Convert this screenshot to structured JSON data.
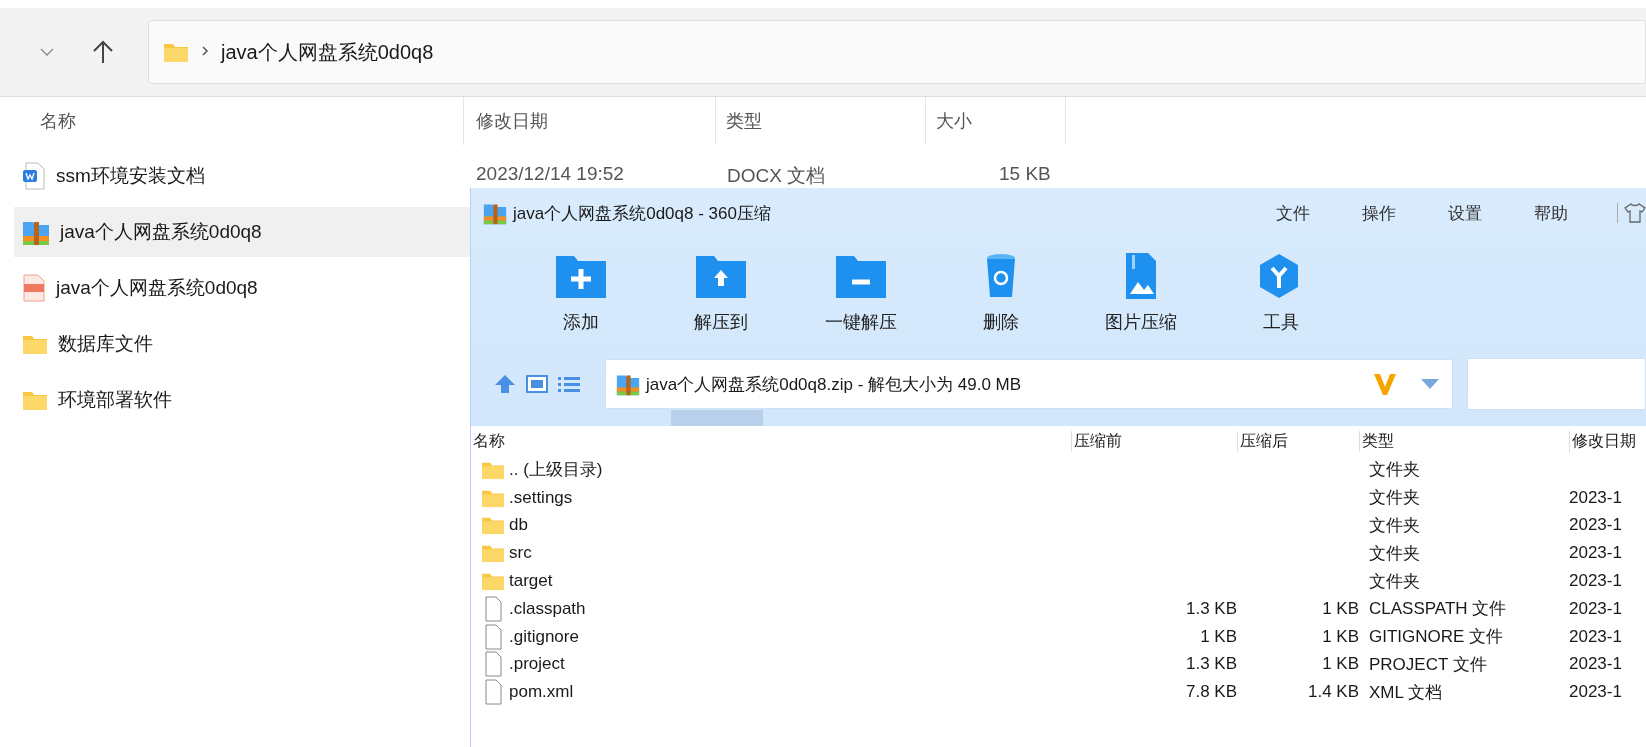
{
  "explorer": {
    "path": "java个人网盘系统0d0q8",
    "columns": [
      "名称",
      "修改日期",
      "类型",
      "大小"
    ],
    "files": [
      {
        "name": "ssm环境安装文档",
        "kind": "word",
        "selected": false,
        "date": "2023/12/14 19:52",
        "type": "DOCX 文档",
        "size": "15 KB"
      },
      {
        "name": "java个人网盘系统0d0q8",
        "kind": "zip",
        "selected": true
      },
      {
        "name": "java个人网盘系统0d0q8",
        "kind": "mp4",
        "selected": false
      },
      {
        "name": "数据库文件",
        "kind": "folder",
        "selected": false
      },
      {
        "name": "环境部署软件",
        "kind": "folder",
        "selected": false
      }
    ]
  },
  "archiver": {
    "title": "java个人网盘系统0d0q8 - 360压缩",
    "menu": [
      "文件",
      "操作",
      "设置",
      "帮助"
    ],
    "tools": [
      {
        "label": "添加",
        "kind": "add"
      },
      {
        "label": "解压到",
        "kind": "extract"
      },
      {
        "label": "一键解压",
        "kind": "oneclick"
      },
      {
        "label": "删除",
        "kind": "delete"
      },
      {
        "label": "图片压缩",
        "kind": "image"
      },
      {
        "label": "工具",
        "kind": "tools"
      }
    ],
    "address": "java个人网盘系统0d0q8.zip - 解包大小为 49.0 MB",
    "columns": [
      "名称",
      "压缩前",
      "压缩后",
      "类型",
      "修改日期"
    ],
    "rows": [
      {
        "kind": "folder",
        "name": ".. (上级目录)",
        "type": "文件夹"
      },
      {
        "kind": "folder",
        "name": ".settings",
        "type": "文件夹",
        "date": "2023-1"
      },
      {
        "kind": "folder",
        "name": "db",
        "type": "文件夹",
        "date": "2023-1"
      },
      {
        "kind": "folder",
        "name": "src",
        "type": "文件夹",
        "date": "2023-1"
      },
      {
        "kind": "folder",
        "name": "target",
        "type": "文件夹",
        "date": "2023-1"
      },
      {
        "kind": "file",
        "name": ".classpath",
        "before": "1.3 KB",
        "after": "1 KB",
        "type": "CLASSPATH 文件",
        "date": "2023-1"
      },
      {
        "kind": "file",
        "name": ".gitignore",
        "before": "1 KB",
        "after": "1 KB",
        "type": "GITIGNORE 文件",
        "date": "2023-1"
      },
      {
        "kind": "file",
        "name": ".project",
        "before": "1.3 KB",
        "after": "1 KB",
        "type": "PROJECT 文件",
        "date": "2023-1"
      },
      {
        "kind": "file",
        "name": "pom.xml",
        "before": "7.8 KB",
        "after": "1.4 KB",
        "type": "XML 文档",
        "date": "2023-1"
      }
    ]
  }
}
